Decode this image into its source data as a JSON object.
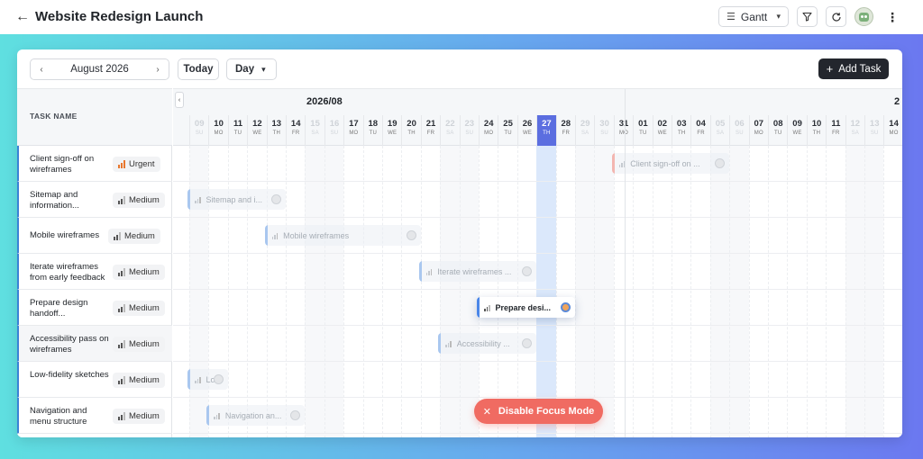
{
  "header": {
    "title": "Website Redesign Launch",
    "view": "Gantt"
  },
  "toolbar": {
    "month": "August 2026",
    "today": "Today",
    "scale": "Day",
    "add_task": "Add Task"
  },
  "columns": {
    "task_name": "TASK NAME"
  },
  "timeline": {
    "months": [
      "2026/08",
      "2"
    ],
    "days": [
      {
        "n": "09",
        "w": "SU",
        "we": true
      },
      {
        "n": "10",
        "w": "MO"
      },
      {
        "n": "11",
        "w": "TU"
      },
      {
        "n": "12",
        "w": "WE"
      },
      {
        "n": "13",
        "w": "TH"
      },
      {
        "n": "14",
        "w": "FR"
      },
      {
        "n": "15",
        "w": "SA",
        "we": true
      },
      {
        "n": "16",
        "w": "SU",
        "we": true
      },
      {
        "n": "17",
        "w": "MO"
      },
      {
        "n": "18",
        "w": "TU"
      },
      {
        "n": "19",
        "w": "WE"
      },
      {
        "n": "20",
        "w": "TH"
      },
      {
        "n": "21",
        "w": "FR"
      },
      {
        "n": "22",
        "w": "SA",
        "we": true
      },
      {
        "n": "23",
        "w": "SU",
        "we": true
      },
      {
        "n": "24",
        "w": "MO"
      },
      {
        "n": "25",
        "w": "TU"
      },
      {
        "n": "26",
        "w": "WE"
      },
      {
        "n": "27",
        "w": "TH",
        "today": true
      },
      {
        "n": "28",
        "w": "FR"
      },
      {
        "n": "29",
        "w": "SA",
        "we": true
      },
      {
        "n": "30",
        "w": "SU",
        "we": true
      },
      {
        "n": "31",
        "w": "MO"
      },
      {
        "n": "01",
        "w": "TU"
      },
      {
        "n": "02",
        "w": "WE"
      },
      {
        "n": "03",
        "w": "TH"
      },
      {
        "n": "04",
        "w": "FR"
      },
      {
        "n": "05",
        "w": "SA",
        "we": true
      },
      {
        "n": "06",
        "w": "SU",
        "we": true
      },
      {
        "n": "07",
        "w": "MO"
      },
      {
        "n": "08",
        "w": "TU"
      },
      {
        "n": "09",
        "w": "WE"
      },
      {
        "n": "10",
        "w": "TH"
      },
      {
        "n": "11",
        "w": "FR"
      },
      {
        "n": "12",
        "w": "SA",
        "we": true
      },
      {
        "n": "13",
        "w": "SU",
        "we": true
      },
      {
        "n": "14",
        "w": "MO"
      },
      {
        "n": "15",
        "w": "TU"
      }
    ]
  },
  "tasks": [
    {
      "name": "Client sign-off on wireframes",
      "priority": "Urgent",
      "level": "urgent",
      "bar": "Client sign-off on ...",
      "start": "2026-08-31",
      "days": 6
    },
    {
      "name": "Sitemap and information...",
      "priority": "Medium",
      "level": "medium",
      "bar": "Sitemap and i...",
      "start": "2026-08-09",
      "days": 5
    },
    {
      "name": "Mobile wireframes",
      "priority": "Medium",
      "level": "medium",
      "bar": "Mobile wireframes",
      "start": "2026-08-13",
      "days": 8
    },
    {
      "name": "Iterate wireframes from early feedback",
      "priority": "Medium",
      "level": "medium",
      "bar": "Iterate wireframes ...",
      "start": "2026-08-21",
      "days": 6
    },
    {
      "name": "Prepare design handoff...",
      "priority": "Medium",
      "level": "medium",
      "bar": "Prepare desi...",
      "start": "2026-08-24",
      "days": 5,
      "active": true
    },
    {
      "name": "Accessibility pass on wireframes",
      "priority": "Medium",
      "level": "medium",
      "bar": "Accessibility ...",
      "start": "2026-08-22",
      "days": 5
    },
    {
      "name": "Low-fidelity sketches",
      "priority": "Medium",
      "level": "medium",
      "bar": "Lo...",
      "start": "2026-08-09",
      "days": 2
    },
    {
      "name": "Navigation and menu structure",
      "priority": "Medium",
      "level": "medium",
      "bar": "Navigation an...",
      "start": "2026-08-10",
      "days": 5
    }
  ],
  "focus_mode": "Disable Focus Mode"
}
